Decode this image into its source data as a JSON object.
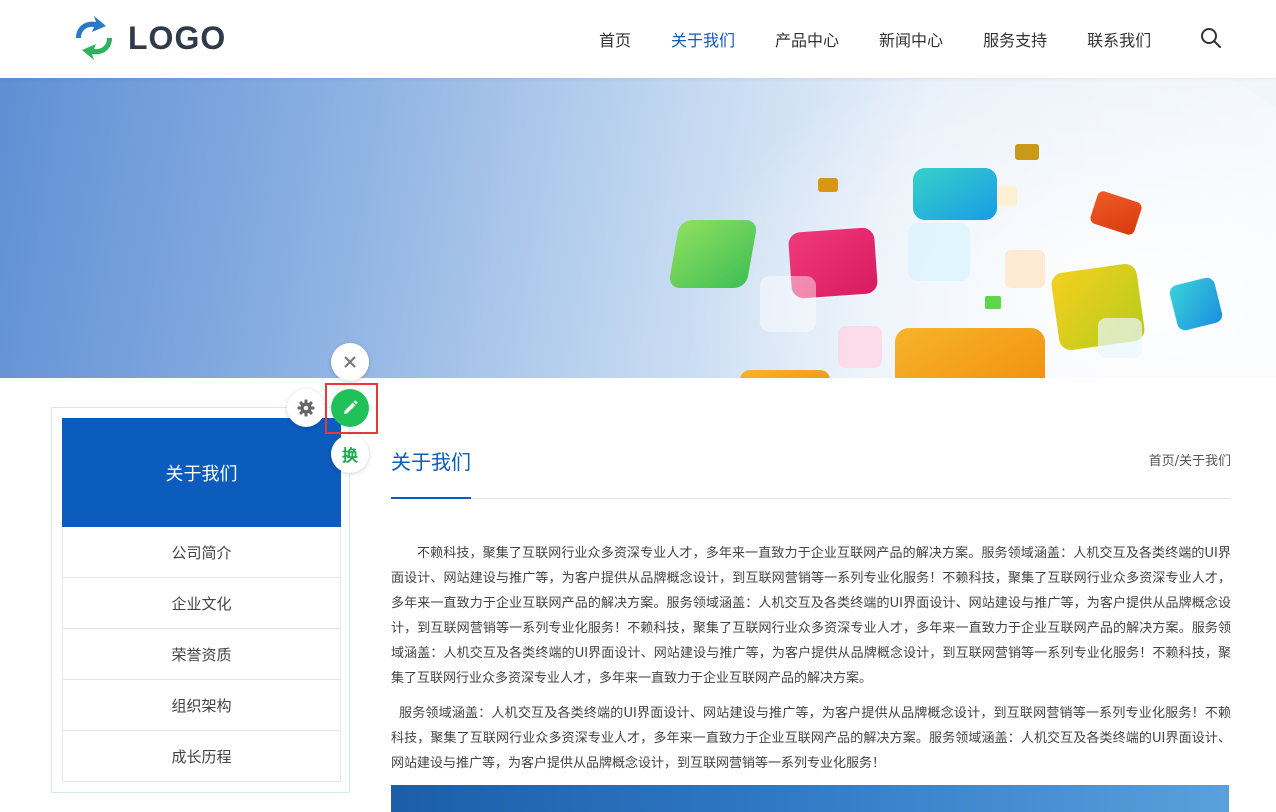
{
  "header": {
    "logo_text": "LOGO",
    "nav": [
      {
        "label": "首页",
        "active": false
      },
      {
        "label": "关于我们",
        "active": true
      },
      {
        "label": "产品中心",
        "active": false
      },
      {
        "label": "新闻中心",
        "active": false
      },
      {
        "label": "服务支持",
        "active": false
      },
      {
        "label": "联系我们",
        "active": false
      }
    ],
    "search_icon": "search-icon"
  },
  "colors": {
    "brand": "#0b5cbd",
    "edit_green": "#21c15a",
    "highlight_red": "#e53a3a"
  },
  "tools": {
    "close_icon": "close-icon",
    "gear_icon": "gear-icon",
    "edit_icon": "pencil-icon",
    "swap_label": "换"
  },
  "sidebar": {
    "title": "关于我们",
    "items": [
      {
        "label": "公司简介"
      },
      {
        "label": "企业文化"
      },
      {
        "label": "荣誉资质"
      },
      {
        "label": "组织架构"
      },
      {
        "label": "成长历程"
      }
    ]
  },
  "main": {
    "title": "关于我们",
    "breadcrumb": "首页/关于我们",
    "paragraphs": [
      "不赖科技，聚集了互联网行业众多资深专业人才，多年来一直致力于企业互联网产品的解决方案。服务领域涵盖：人机交互及各类终端的UI界面设计、网站建设与推广等，为客户提供从品牌概念设计，到互联网营销等一系列专业化服务！不赖科技，聚集了互联网行业众多资深专业人才，多年来一直致力于企业互联网产品的解决方案。服务领域涵盖：人机交互及各类终端的UI界面设计、网站建设与推广等，为客户提供从品牌概念设计，到互联网营销等一系列专业化服务！不赖科技，聚集了互联网行业众多资深专业人才，多年来一直致力于企业互联网产品的解决方案。服务领域涵盖：人机交互及各类终端的UI界面设计、网站建设与推广等，为客户提供从品牌概念设计，到互联网营销等一系列专业化服务！不赖科技，聚集了互联网行业众多资深专业人才，多年来一直致力于企业互联网产品的解决方案。",
      "服务领域涵盖：人机交互及各类终端的UI界面设计、网站建设与推广等，为客户提供从品牌概念设计，到互联网营销等一系列专业化服务！不赖科技，聚集了互联网行业众多资深专业人才，多年来一直致力于企业互联网产品的解决方案。服务领域涵盖：人机交互及各类终端的UI界面设计、网站建设与推广等，为客户提供从品牌概念设计，到互联网营销等一系列专业化服务！"
    ]
  }
}
